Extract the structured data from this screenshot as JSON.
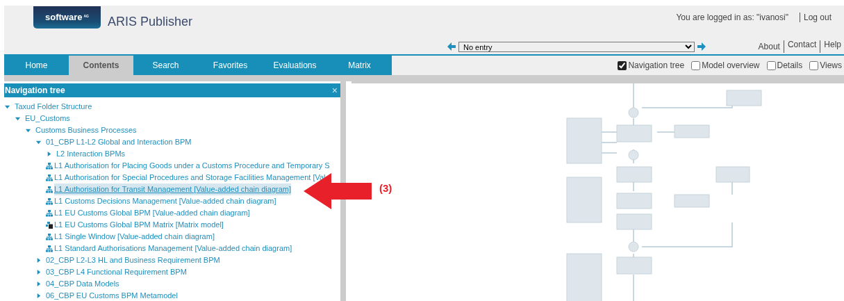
{
  "header": {
    "logo": "software",
    "logo_suffix": "AG",
    "title": "ARIS Publisher",
    "login_text": "You are logged in as: \"ivanosi\"",
    "logout": "Log out"
  },
  "history": {
    "value": "No entry"
  },
  "links": [
    "About",
    "Contact",
    "Help"
  ],
  "tabs": [
    {
      "label": "Home",
      "selected": false
    },
    {
      "label": "Contents",
      "selected": true
    },
    {
      "label": "Search",
      "selected": false
    },
    {
      "label": "Favorites",
      "selected": false
    },
    {
      "label": "Evaluations",
      "selected": false
    },
    {
      "label": "Matrix",
      "selected": false
    }
  ],
  "view_options": [
    {
      "label": "Navigation tree",
      "checked": true
    },
    {
      "label": "Model overview",
      "checked": false
    },
    {
      "label": "Details",
      "checked": false
    },
    {
      "label": "Views",
      "checked": false
    }
  ],
  "nav_tree": {
    "title": "Navigation tree",
    "close": "×",
    "items": [
      {
        "label": "Taxud Folder Structure",
        "kind": "folder",
        "expanded": true,
        "selected": false,
        "children": [
          {
            "label": "EU_Customs",
            "kind": "folder",
            "expanded": true,
            "selected": false,
            "children": [
              {
                "label": "Customs Business Processes",
                "kind": "folder",
                "expanded": true,
                "selected": false,
                "children": [
                  {
                    "label": "01_CBP L1-L2 Global and Interaction BPM",
                    "kind": "folder",
                    "expanded": true,
                    "selected": false,
                    "children": [
                      {
                        "label": "L2 Interaction BPMs",
                        "kind": "folder",
                        "expanded": false,
                        "selected": false
                      },
                      {
                        "label": "L1 Authorisation for Placing Goods under a Customs Procedure and Temporary S",
                        "kind": "diagram",
                        "selected": false
                      },
                      {
                        "label": "L1 Authorisation for Special Procedures and Storage Facilities Management [Val",
                        "kind": "diagram",
                        "selected": false
                      },
                      {
                        "label": "L1 Authorisation for Transit Management [Value-added chain diagram]",
                        "kind": "diagram",
                        "selected": true
                      },
                      {
                        "label": "L1 Customs Decisions Management [Value-added chain diagram]",
                        "kind": "diagram",
                        "selected": false
                      },
                      {
                        "label": "L1 EU Customs Global BPM [Value-added chain diagram]",
                        "kind": "diagram",
                        "selected": false
                      },
                      {
                        "label": "L1 EU Customs Global BPM Matrix [Matrix model]",
                        "kind": "matrix",
                        "selected": false
                      },
                      {
                        "label": "L1 Single Window [Value-added chain diagram]",
                        "kind": "diagram",
                        "selected": false
                      },
                      {
                        "label": "L1 Standard Authorisations Management [Value-added chain diagram]",
                        "kind": "diagram",
                        "selected": false
                      }
                    ]
                  },
                  {
                    "label": "02_CBP L2-L3 HL and Business Requirement BPM",
                    "kind": "folder",
                    "expanded": false,
                    "selected": false
                  },
                  {
                    "label": "03_CBP L4 Functional Requirement BPM",
                    "kind": "folder",
                    "expanded": false,
                    "selected": false
                  },
                  {
                    "label": "04_CBP Data Models",
                    "kind": "folder",
                    "expanded": false,
                    "selected": false
                  },
                  {
                    "label": "06_CBP EU Customs BPM Metamodel",
                    "kind": "folder",
                    "expanded": false,
                    "selected": false
                  }
                ]
              }
            ]
          }
        ]
      }
    ]
  },
  "callout": {
    "label": "(3)"
  }
}
